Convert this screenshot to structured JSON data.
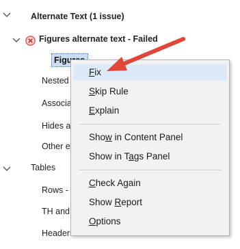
{
  "tree": {
    "alternate_text": "Alternate Text (1 issue)",
    "figures_failed": "Figures alternate text - Failed",
    "selected_item": "Figures",
    "items": [
      "Nested",
      "Associa",
      "Hides an",
      "Other el"
    ],
    "tables": "Tables",
    "table_items": [
      "Rows - T",
      "TH and",
      "Headers - Passed"
    ]
  },
  "context_menu": {
    "fix": {
      "u": "F",
      "rest": "ix"
    },
    "skip_rule": {
      "u": "S",
      "rest": "kip Rule"
    },
    "explain": {
      "u": "E",
      "rest": "xplain"
    },
    "show_content": {
      "pre": "Sho",
      "u": "w",
      "rest": " in Content Panel"
    },
    "show_tags": {
      "pre": "Show in T",
      "u": "a",
      "rest": "gs Panel"
    },
    "check_again": {
      "u": "C",
      "rest": "heck Again"
    },
    "show_report": {
      "pre": "Show ",
      "u": "R",
      "rest": "eport"
    },
    "options": {
      "u": "O",
      "rest": "ptions"
    }
  },
  "colors": {
    "menu_bg": "#f2f2f2",
    "hover_bg": "#dce9f7",
    "arrow": "#e0463a",
    "fail_icon": "#d9534f",
    "selection": "#c9ddf3"
  },
  "icons": [
    "chevron-down-icon",
    "failed-icon",
    "annotation-arrow"
  ]
}
